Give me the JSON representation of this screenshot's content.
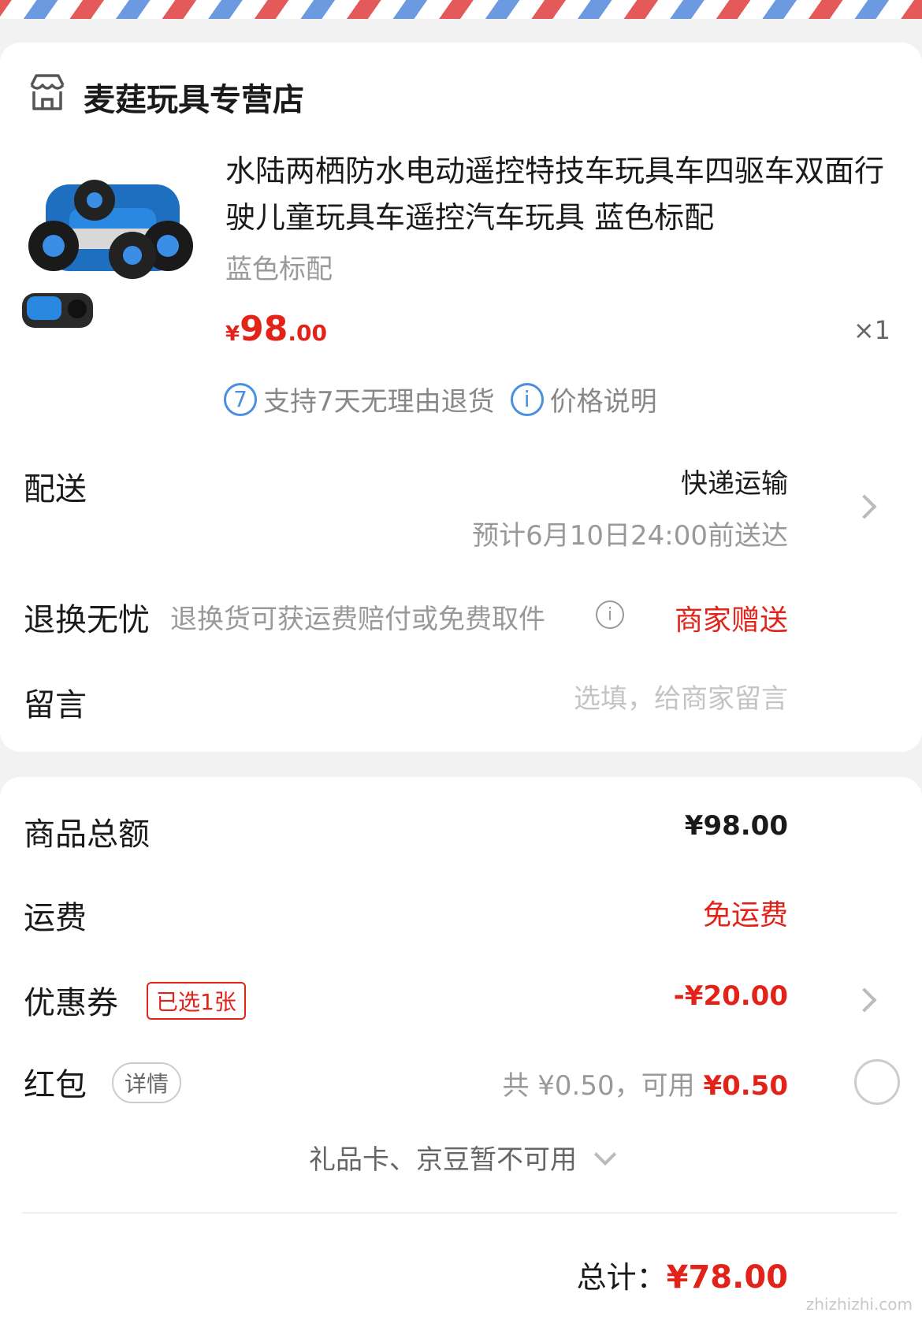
{
  "store": {
    "name": "麦莛玩具专营店",
    "icon": "store-icon"
  },
  "product": {
    "title": "水陆两栖防水电动遥控特技车玩具车四驱车双面行驶儿童玩具车遥控汽车玩具 蓝色标配",
    "variant": "蓝色标配",
    "price_currency": "¥",
    "price_int": "98",
    "price_dec": ".00",
    "quantity": "×1",
    "tags": [
      {
        "icon_text": "7",
        "label": "支持7天无理由退货"
      },
      {
        "icon_text": "i",
        "label": "价格说明"
      }
    ]
  },
  "delivery": {
    "label": "配送",
    "type": "快递运输",
    "eta": "预计6月10日24:00前送达"
  },
  "returns": {
    "label": "退换无忧",
    "desc": "退换货可获运费赔付或免费取件",
    "value": "商家赠送"
  },
  "message": {
    "label": "留言",
    "placeholder": "选填，给商家留言"
  },
  "summary": {
    "subtotal_label": "商品总额",
    "subtotal_value": "¥98.00",
    "shipping_label": "运费",
    "shipping_value": "免运费",
    "coupon_label": "优惠券",
    "coupon_badge": "已选1张",
    "coupon_value": "-¥20.00",
    "hongbao_label": "红包",
    "hongbao_detail": "详情",
    "hongbao_total": "共 ¥0.50，可用",
    "hongbao_available": "¥0.50",
    "gift_note": "礼品卡、京豆暂不可用",
    "grand_label": "总计：",
    "grand_value": "¥78.00"
  },
  "watermark": "zhizhizhi.com",
  "colors": {
    "accent_red": "#e2231a",
    "badge_blue": "#4a8fe0"
  }
}
